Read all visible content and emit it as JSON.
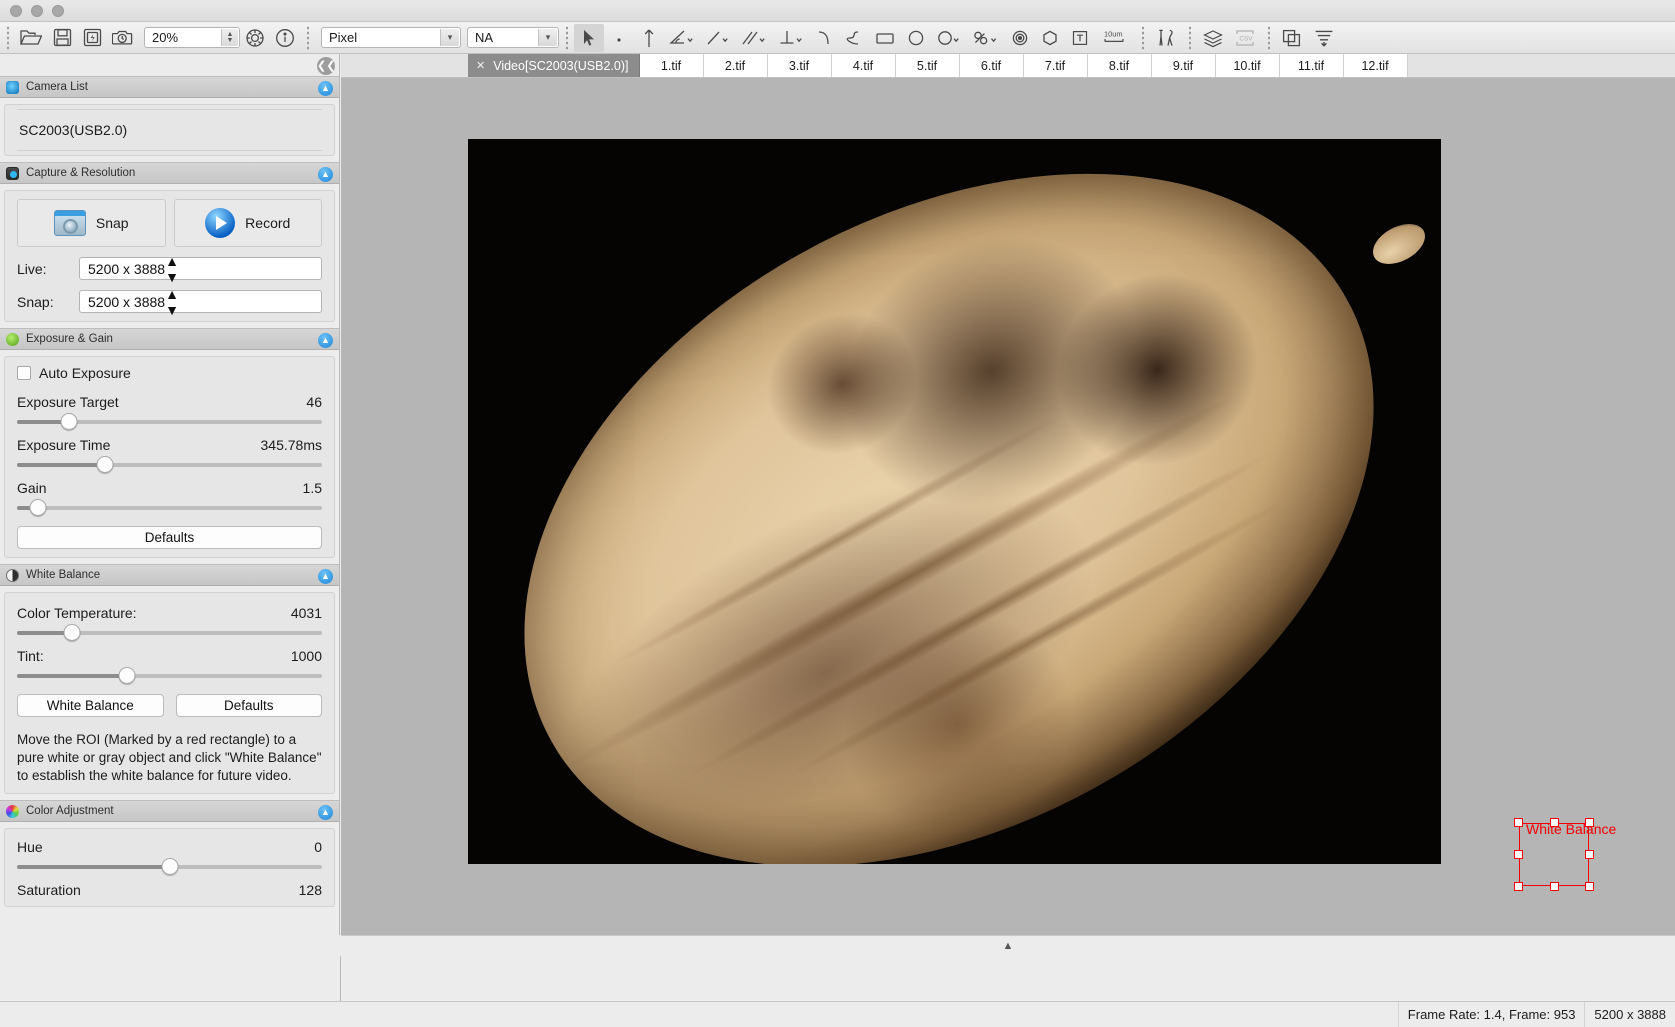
{
  "titlebar": {
    "buttons": [
      "close",
      "minimize",
      "maximize"
    ]
  },
  "toolbar": {
    "open_icon": "open-folder-icon",
    "save_icon": "save-disk-icon",
    "batch_save_icon": "batch-save-icon",
    "timed_capture_icon": "timed-capture-icon",
    "zoom_value": "20%",
    "settings_icon": "gear-icon",
    "info_icon": "info-icon",
    "unit_value": "Pixel",
    "na_value": "NA",
    "select_icon": "arrow-pointer-icon",
    "point_icon": "point-icon",
    "line_vertical_icon": "arrow-up-icon",
    "angle_icon": "angle-icon",
    "line_icon": "line-icon",
    "parallel_icon": "parallel-lines-icon",
    "perpendicular_icon": "perpendicular-icon",
    "arc_icon": "arc-icon",
    "curve_icon": "s-curve-icon",
    "rectangle_icon": "rectangle-icon",
    "ellipse_icon": "ellipse-icon",
    "circle_icon": "circle-icon",
    "chain_icon": "chain-circles-icon",
    "annulus_icon": "concentric-circles-icon",
    "polygon_icon": "polygon-icon",
    "text_icon": "text-icon",
    "scalebar_icon": "scale-bar-icon",
    "scalebar_label": "10um",
    "calibration_icon": "calibration-tools-icon",
    "layers_icon": "layers-icon",
    "csv_icon": "csv-export-icon",
    "compare_icon": "compare-icon",
    "align_icon": "align-icon"
  },
  "sidebar": {
    "collapse_icon": "chevron-left-icon",
    "panels": [
      {
        "id": "camera-list",
        "title": "Camera List",
        "icon": "camera-list-icon",
        "toggle_icon": "chevron-up-icon",
        "camera": "SC2003(USB2.0)"
      },
      {
        "id": "capture-resolution",
        "title": "Capture & Resolution",
        "icon": "capture-icon",
        "toggle_icon": "chevron-up-icon",
        "snap_label": "Snap",
        "snap_icon": "snap-camera-icon",
        "record_label": "Record",
        "record_icon": "record-play-icon",
        "live_label": "Live:",
        "live_value": "5200 x 3888",
        "snap_res_label": "Snap:",
        "snap_res_value": "5200 x 3888"
      },
      {
        "id": "exposure-gain",
        "title": "Exposure & Gain",
        "icon": "exposure-icon",
        "toggle_icon": "chevron-up-icon",
        "auto_exposure_label": "Auto Exposure",
        "auto_exposure_checked": false,
        "exposure_target_label": "Exposure Target",
        "exposure_target_value": "46",
        "exposure_target_pct": 17,
        "exposure_time_label": "Exposure Time",
        "exposure_time_value": "345.78ms",
        "exposure_time_pct": 29,
        "gain_label": "Gain",
        "gain_value": "1.5",
        "gain_pct": 7,
        "defaults_label": "Defaults"
      },
      {
        "id": "white-balance",
        "title": "White Balance",
        "icon": "white-balance-icon",
        "toggle_icon": "chevron-up-icon",
        "color_temp_label": "Color Temperature:",
        "color_temp_value": "4031",
        "color_temp_pct": 18,
        "tint_label": "Tint:",
        "tint_value": "1000",
        "tint_pct": 36,
        "white_balance_button": "White Balance",
        "defaults_button": "Defaults",
        "hint": "Move the ROI (Marked by a red rectangle) to a pure white or gray object and click \"White Balance\" to establish the white balance for future video."
      },
      {
        "id": "color-adjustment",
        "title": "Color Adjustment",
        "icon": "color-wheel-icon",
        "toggle_icon": "chevron-up-icon",
        "hue_label": "Hue",
        "hue_value": "0",
        "hue_pct": 50,
        "saturation_label": "Saturation",
        "saturation_value": "128"
      }
    ]
  },
  "tabs": {
    "active_close_icon": "close-icon",
    "items": [
      {
        "label": "Video[SC2003(USB2.0)]",
        "active": true
      },
      {
        "label": "1.tif",
        "active": false
      },
      {
        "label": "2.tif",
        "active": false
      },
      {
        "label": "3.tif",
        "active": false
      },
      {
        "label": "4.tif",
        "active": false
      },
      {
        "label": "5.tif",
        "active": false
      },
      {
        "label": "6.tif",
        "active": false
      },
      {
        "label": "7.tif",
        "active": false
      },
      {
        "label": "8.tif",
        "active": false
      },
      {
        "label": "9.tif",
        "active": false
      },
      {
        "label": "10.tif",
        "active": false
      },
      {
        "label": "11.tif",
        "active": false
      },
      {
        "label": "12.tif",
        "active": false
      }
    ]
  },
  "viewport": {
    "roi_label": "White Balance",
    "roi_color": "#f50000",
    "collapse_handle_icon": "chevron-up-icon"
  },
  "statusbar": {
    "frame_info": "Frame Rate: 1.4, Frame: 953",
    "resolution": "5200 x 3888"
  }
}
